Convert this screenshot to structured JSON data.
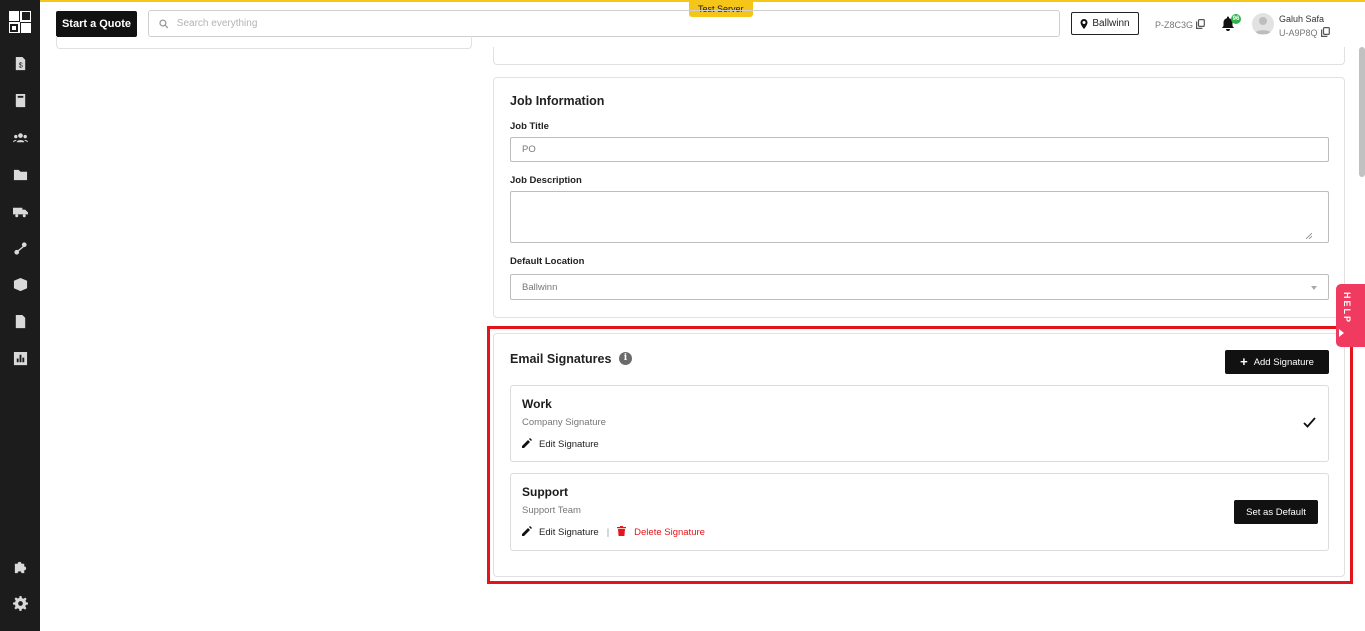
{
  "header": {
    "start_quote": "Start a Quote",
    "search_placeholder": "Search everything",
    "server_badge": "Test Server",
    "location": "Ballwinn",
    "project_id": "P-Z8C3G",
    "notification_count": "96",
    "user_name": "Galuh Safa",
    "user_id": "U-A9P8Q"
  },
  "sidebar": {
    "items": [
      {
        "icon": "invoice-dollar-icon"
      },
      {
        "icon": "book-icon"
      },
      {
        "icon": "users-icon"
      },
      {
        "icon": "folder-icon"
      },
      {
        "icon": "truck-icon"
      },
      {
        "icon": "route-icon"
      },
      {
        "icon": "box-icon"
      },
      {
        "icon": "document-icon"
      },
      {
        "icon": "chart-icon"
      },
      {
        "icon": "puzzle-icon"
      },
      {
        "icon": "gear-icon"
      }
    ]
  },
  "job_info": {
    "title": "Job Information",
    "job_title_label": "Job Title",
    "job_title_value": "PO",
    "job_description_label": "Job Description",
    "job_description_value": "",
    "default_location_label": "Default Location",
    "default_location_value": "Ballwinn"
  },
  "email_signatures": {
    "title": "Email Signatures",
    "add_label": "Add Signature",
    "items": [
      {
        "name": "Work",
        "subtitle": "Company Signature",
        "edit_label": "Edit Signature",
        "is_default": true
      },
      {
        "name": "Support",
        "subtitle": "Support Team",
        "edit_label": "Edit Signature",
        "delete_label": "Delete Signature",
        "default_button": "Set as Default",
        "is_default": false
      }
    ]
  },
  "help": {
    "label": "HELP"
  },
  "colors": {
    "accent": "#f5c518",
    "danger": "#e3151a",
    "help": "#f03a5f",
    "dark": "#111111"
  }
}
